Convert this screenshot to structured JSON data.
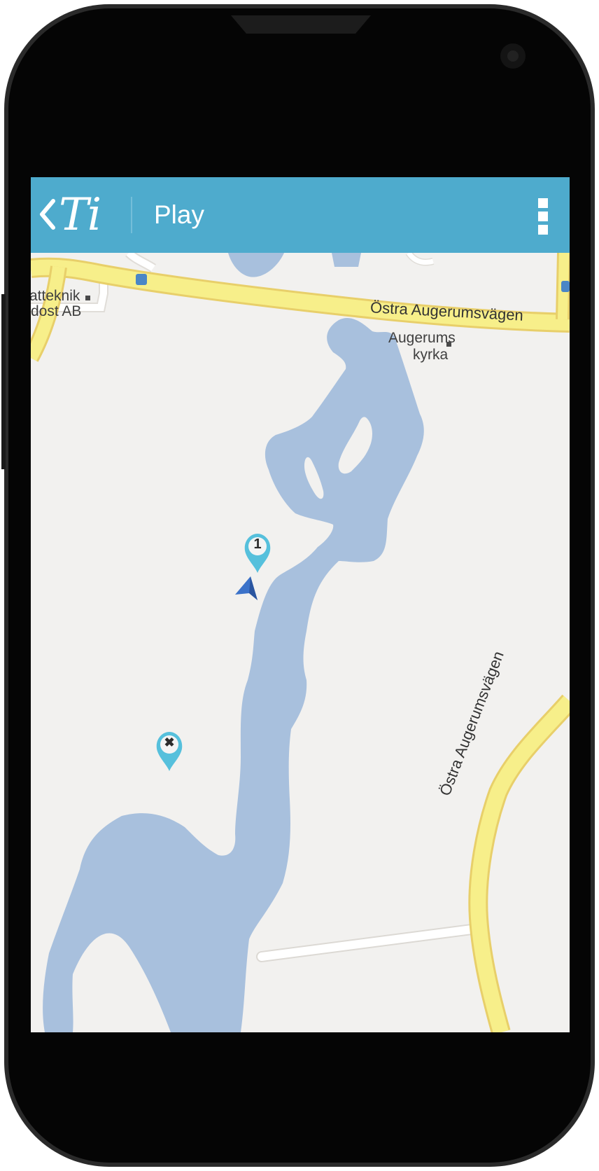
{
  "app": {
    "logo": "Ti",
    "title": "Play",
    "accent_color": "#4eabcd"
  },
  "map": {
    "streets": {
      "top": "Östra Augerumsvägen",
      "right": "Östra Augerumsvägen"
    },
    "places": {
      "church_line1": "Augerums",
      "church_line2": "kyrka",
      "company_line1": "atteknik",
      "company_line2": "dost AB"
    },
    "markers": {
      "numbered_label": "1",
      "cross_label": "✖"
    },
    "colors": {
      "land": "#f2f1ef",
      "water": "#a8c0dd",
      "road": "#f7ef8a",
      "road_border": "#e8cf6a",
      "marker": "#56c0dc"
    }
  },
  "icons": {
    "back": "chevron-left-icon",
    "overflow": "overflow-menu-icon",
    "location": "location-arrow-icon",
    "bus": "bus-stop-icon"
  }
}
